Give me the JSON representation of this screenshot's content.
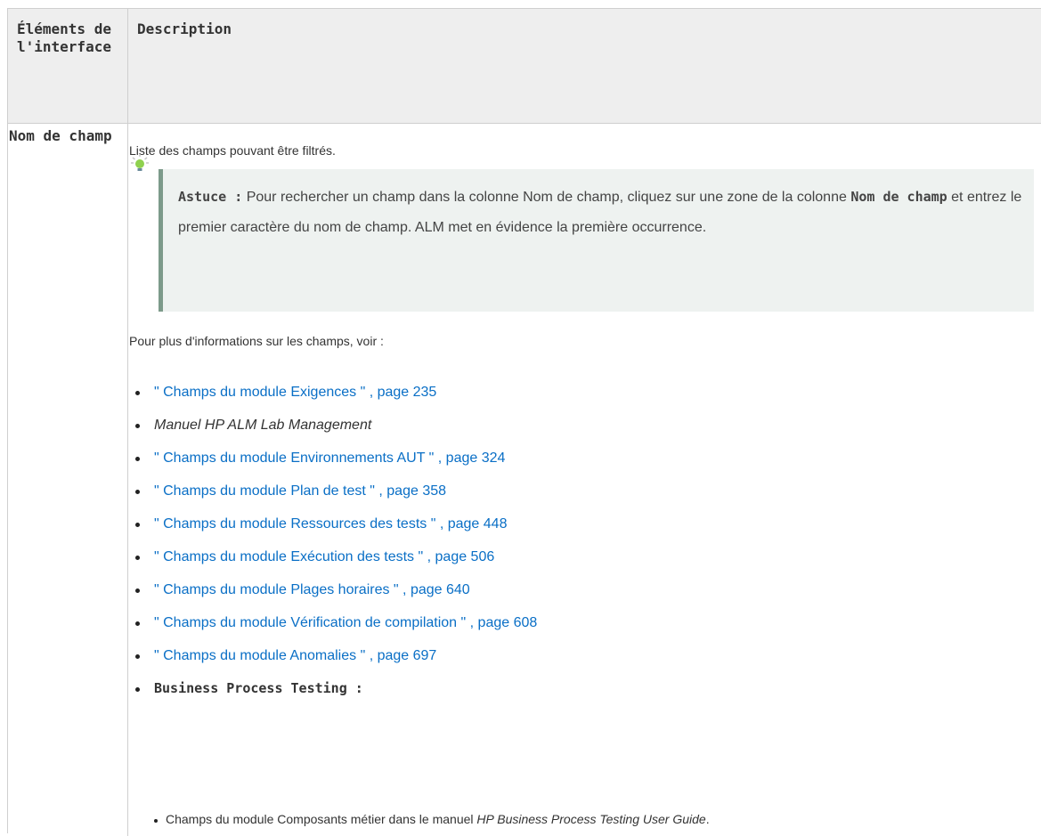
{
  "table": {
    "header": {
      "col1": "Éléments de l'interface",
      "col2": "Description"
    },
    "row": {
      "name": "Nom de champ",
      "intro": "Liste des champs pouvant être filtrés.",
      "tip": {
        "label": "Astuce :",
        "text1": " Pour rechercher un champ dans la colonne Nom de champ, cliquez sur une zone de la colonne ",
        "bold": "Nom de champ",
        "text2": " et entrez le premier caractère du nom de champ. ALM met en évidence la première occurrence.",
        "icon": "lightbulb-icon"
      },
      "more_info": "Pour plus d'informations sur les champs, voir :",
      "links": [
        "\" Champs du module Exigences \" , page 235",
        "Manuel HP ALM Lab Management",
        "\" Champs du module Environnements AUT \" , page 324",
        "\" Champs du module Plan de test \" , page 358",
        "\" Champs du module Ressources des tests \" , page 448",
        "\" Champs du module Exécution des tests \" , page 506",
        "\" Champs du module Plages horaires \" , page 640",
        "\" Champs du module Vérification de compilation \" , page 608",
        "\" Champs du module Anomalies \" , page 697",
        "Business Process Testing :"
      ],
      "sub_item": {
        "prefix": "Champs du module Composants métier dans le manuel ",
        "italic": "HP Business Process Testing User Guide",
        "suffix": "."
      }
    }
  },
  "colors": {
    "link": "#0a6fc6",
    "header_bg": "#eeeeee",
    "tip_bg": "#eef2f0",
    "tip_border": "#7c9a8a"
  }
}
